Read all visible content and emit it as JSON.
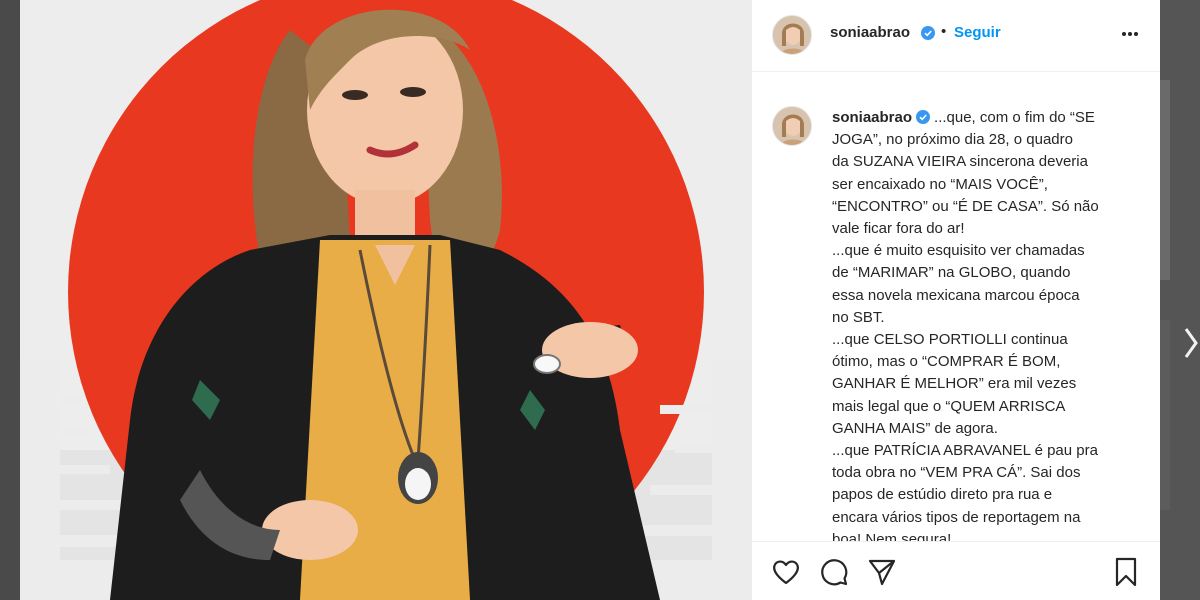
{
  "post": {
    "username": "soniaabrao",
    "follow_label": "Seguir",
    "dot": "•",
    "caption_lines": [
      "...que, com o fim do “SE",
      "JOGA”, no próximo dia 28, o quadro",
      "da SUZANA VIEIRA sincerona deveria",
      "ser encaixado no “MAIS VOCÊ”,",
      "“ENCONTRO” ou “É DE CASA”. Só não",
      "vale ficar fora do ar!",
      "...que é muito esquisito ver chamadas",
      "de “MARIMAR” na GLOBO, quando",
      "essa novela mexicana marcou época",
      "no SBT.",
      "...que CELSO PORTIOLLI continua",
      "ótimo, mas o “COMPRAR É BOM,",
      "GANHAR É MELHOR” era mil vezes",
      "mais legal que o “QUEM ARRISCA",
      "GANHA MAIS” de agora.",
      "...que PATRÍCIA ABRAVANEL é pau pra",
      "toda obra no “VEM PRA CÁ”. Sai dos",
      "papos de estúdio direto pra rua e",
      "encara vários tipos de reportagem na",
      "boa! Nem segura!"
    ]
  },
  "icons": {
    "verified": "verified-badge-icon",
    "more": "more-options-icon",
    "like": "heart-icon",
    "comment": "comment-icon",
    "share": "share-icon",
    "save": "bookmark-icon",
    "next": "chevron-right-icon"
  },
  "colors": {
    "accent_blue": "#0095f6",
    "verified_blue": "#3897f0",
    "sun_red": "#e8381f",
    "jacket": "#1d1d1d",
    "blouse": "#e8ad46"
  }
}
